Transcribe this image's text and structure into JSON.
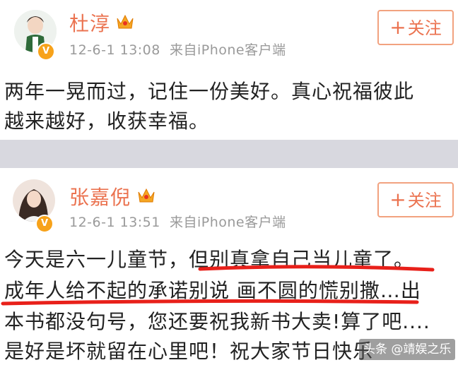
{
  "posts": [
    {
      "username": "杜淳",
      "time": "12-6-1 13:08",
      "source": "来自iPhone客户端",
      "follow_label": "关注",
      "follow_plus": "+",
      "verified_mark": "V",
      "lines": [
        "两年一晃而过，记住一份美好。真心祝福彼此",
        "越来越好，收获幸福。"
      ]
    },
    {
      "username": "张嘉倪",
      "time": "12-6-1 13:51",
      "source": "来自iPhone客户端",
      "follow_label": "关注",
      "follow_plus": "+",
      "verified_mark": "V",
      "lines": [
        "今天是六一儿童节，但别真拿自己当儿童了。",
        "成年人给不起的承诺别说 画不圆的慌别撒…出",
        "本书都没句号，您还要祝我新书大卖!算了吧....",
        "是好是坏就留在心里吧！祝大家节日快乐"
      ]
    }
  ],
  "watermark": "头条 @靖娱之乐",
  "colors": {
    "accent": "#eb7350",
    "underline": "#e8201a",
    "badge": "#f7a21a"
  }
}
